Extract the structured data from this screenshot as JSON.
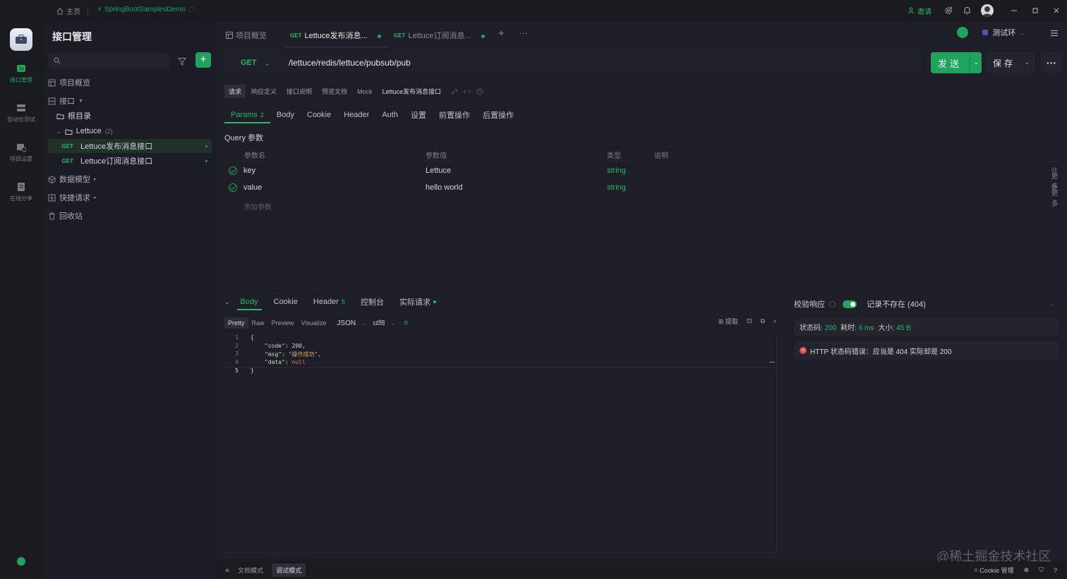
{
  "titlebar": {
    "home_label": "主页",
    "project_tab": "SpringBootSamplesDemo",
    "invite_label": "邀请"
  },
  "rail": {
    "items": [
      {
        "label": "接口管理",
        "icon": "api-icon"
      },
      {
        "label": "自动化测试",
        "icon": "automation-icon"
      },
      {
        "label": "项目设置",
        "icon": "settings-icon"
      },
      {
        "label": "在线分享",
        "icon": "share-icon"
      }
    ]
  },
  "sidebar": {
    "title": "接口管理",
    "search_placeholder": "",
    "tree": {
      "overview": "项目概览",
      "apis": "接口",
      "root": "根目录",
      "folder": "Lettuce",
      "folder_count": "(2)",
      "items": [
        {
          "method": "GET",
          "name": "Lettuce发布消息接口"
        },
        {
          "method": "GET",
          "name": "Lettuce订阅消息接口"
        }
      ],
      "data_models": "数据模型",
      "quick_requests": "快捷请求",
      "trash": "回收站"
    }
  },
  "tabs": [
    {
      "label": "项目概览"
    },
    {
      "method": "GET",
      "label": "Lettuce发布消息..."
    },
    {
      "method": "GET",
      "label": "Lettuce订阅消息..."
    }
  ],
  "env": {
    "name": "测试环"
  },
  "request": {
    "method": "GET",
    "url": "/lettuce/redis/lettuce/pubsub/pub",
    "send_label": "发送",
    "save_label": "保存"
  },
  "doc_tabs": [
    "请求",
    "响应定义",
    "接口说明",
    "预览文档",
    "Mock",
    "Lettuce发布消息接口"
  ],
  "req_tabs": [
    {
      "label": "Params",
      "count": "2"
    },
    {
      "label": "Body"
    },
    {
      "label": "Cookie"
    },
    {
      "label": "Header"
    },
    {
      "label": "Auth"
    },
    {
      "label": "设置"
    },
    {
      "label": "前置操作"
    },
    {
      "label": "后置操作"
    }
  ],
  "query": {
    "title": "Query 参数",
    "headers": {
      "name": "参数名",
      "value": "参数值",
      "type": "类型",
      "desc": "说明"
    },
    "rows": [
      {
        "name": "key",
        "value": "Lettuce",
        "type": "string",
        "more": "更多"
      },
      {
        "name": "value",
        "value": "hello world",
        "type": "string",
        "more": "更多"
      }
    ],
    "add_placeholder": "添加参数"
  },
  "response": {
    "tabs": [
      {
        "label": "Body"
      },
      {
        "label": "Cookie"
      },
      {
        "label": "Header",
        "count": "5"
      },
      {
        "label": "控制台"
      },
      {
        "label": "实际请求"
      }
    ],
    "view_modes": [
      "Pretty",
      "Raw",
      "Preview",
      "Visualize"
    ],
    "format": "JSON",
    "encoding": "utf8",
    "extract_label": "提取",
    "code_lines": [
      {
        "n": "1",
        "text": "{"
      },
      {
        "n": "2",
        "key": "\"code\"",
        "val": "200",
        "type": "num",
        "tail": ","
      },
      {
        "n": "3",
        "key": "\"msg\"",
        "val": "\"操作成功\"",
        "type": "str",
        "tail": ","
      },
      {
        "n": "4",
        "key": "\"data\"",
        "val": "null",
        "type": "null",
        "tail": ""
      },
      {
        "n": "5",
        "text": "}"
      }
    ]
  },
  "validate": {
    "label": "校验响应",
    "record_label": "记录不存在 (404)",
    "status_label": "状态码:",
    "status_value": "200",
    "time_label": "耗时:",
    "time_value": "6 ms",
    "size_label": "大小:",
    "size_value": "45 B",
    "error_text": "HTTP 状态码错误：应当是 404 实际却是 200"
  },
  "bottombar": {
    "modes": [
      "文档模式",
      "调试模式"
    ],
    "cookie_label": "Cookie 管理"
  },
  "watermark": "@稀土掘金技术社区",
  "colors": {
    "accent": "#1fa35d",
    "background": "#1e1e26",
    "error": "#e04848"
  }
}
